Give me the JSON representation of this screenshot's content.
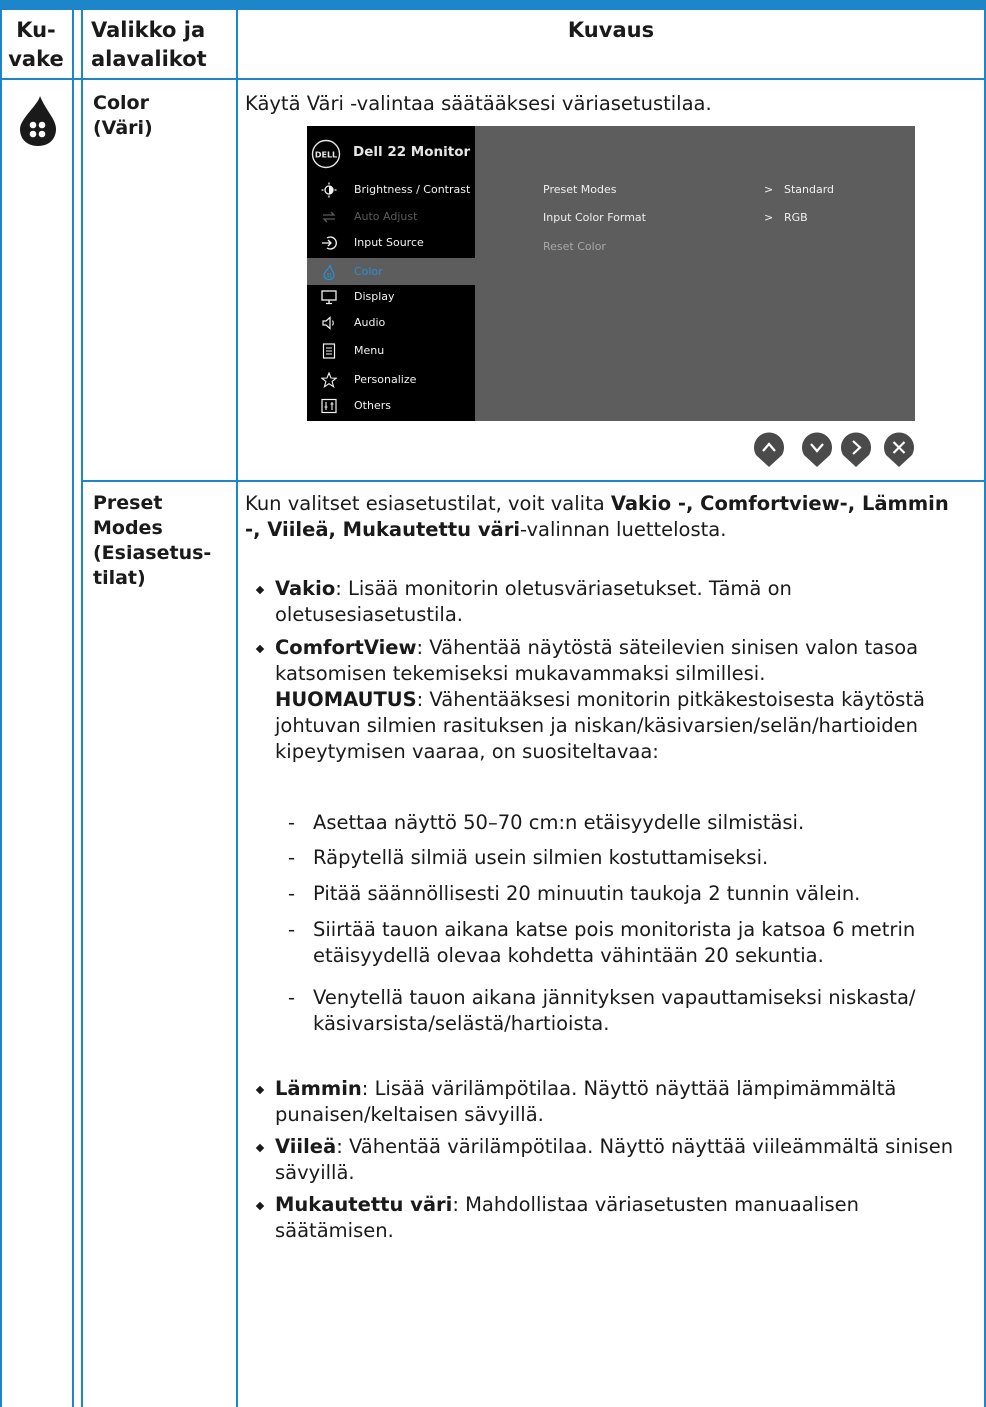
{
  "header": {
    "col_icon": "Ku-\nvake",
    "col_icon_l1": "Ku-",
    "col_icon_l2": "vake",
    "col_menu_l1": "Valikko ja",
    "col_menu_l2": "alavalikot",
    "col_desc": "Kuvaus"
  },
  "row1": {
    "icon": "color-droplet-icon",
    "menu_l1": "Color",
    "menu_l2": "(Väri)",
    "description": "Käytä Väri -valintaa säätääksesi väriasetustilaa."
  },
  "osd": {
    "title": "Dell 22 Monitor",
    "logo_text": "DELL",
    "menu_items": [
      {
        "label": "Brightness / Contrast",
        "icon": "brightness-icon",
        "state": "normal"
      },
      {
        "label": "Auto Adjust",
        "icon": "auto-adjust-icon",
        "state": "disabled"
      },
      {
        "label": "Input Source",
        "icon": "input-source-icon",
        "state": "normal"
      },
      {
        "label": "Color",
        "icon": "color-icon",
        "state": "selected"
      },
      {
        "label": "Display",
        "icon": "display-icon",
        "state": "normal"
      },
      {
        "label": "Audio",
        "icon": "audio-icon",
        "state": "normal"
      },
      {
        "label": "Menu",
        "icon": "menu-icon",
        "state": "normal"
      },
      {
        "label": "Personalize",
        "icon": "star-icon",
        "state": "normal"
      },
      {
        "label": "Others",
        "icon": "others-icon",
        "state": "normal"
      }
    ],
    "submenu": [
      {
        "label": "Preset Modes",
        "arrow": ">",
        "value": "Standard"
      },
      {
        "label": "Input Color Format",
        "arrow": ">",
        "value": "RGB"
      },
      {
        "label": "Reset Color",
        "arrow": "",
        "value": ""
      }
    ],
    "nav_buttons": [
      "up-icon",
      "down-icon",
      "right-icon",
      "close-icon"
    ],
    "colors": {
      "sidebar": "#000000",
      "panel": "#5d5d5d",
      "selected_text": "#2a8fd6",
      "button": "#4a4a4a"
    }
  },
  "row2": {
    "menu_l1": "Preset",
    "menu_l2": "Modes",
    "menu_l3": "(Esiasetus-",
    "menu_l4": "tilat)",
    "intro_a": "Kun valitset esiasetustilat, voit valita ",
    "intro_b1": "Vakio -, Comfortview-, Lämmin",
    "intro_b2": "-, Viileä, Mukautettu väri",
    "intro_c": "-valinnan luettelosta.",
    "vakio_term": "Vakio",
    "vakio_l1": ": Lisää monitorin oletusväriasetukset. Tämä on",
    "vakio_l2": "oletusesiasetustila.",
    "cv_term": "ComfortView",
    "cv_l1": ": Vähentää näytöstä säteilevien sinisen valon tasoa",
    "cv_l2": "katsomisen tekemiseksi mukavammaksi silmillesi.",
    "note_term": "HUOMAUTUS",
    "note_l1": ": Vähentääksesi monitorin pitkäkestoisesta käytöstä",
    "note_l2": "johtuvan silmien rasituksen ja niskan/käsivarsien/selän/hartioiden",
    "note_l3": "kipeytymisen vaaraa, on suositeltavaa:",
    "dash_items": [
      "Asettaa näyttö 50–70 cm:n etäisyydelle silmistäsi.",
      "Räpytellä silmiä usein silmien kostuttamiseksi.",
      "Pitää säännöllisesti 20 minuutin taukoja 2 tunnin välein.",
      "Siirtää tauon aikana katse pois monitorista ja katsoa 6 metrin",
      "etäisyydellä olevaa kohdetta vähintään 20 sekuntia.",
      "Venytellä tauon aikana jännityksen vapauttamiseksi niskasta/",
      "käsivarsista/selästä/hartioista."
    ],
    "warm_term": "Lämmin",
    "warm_l1": ": Lisää värilämpötilaa. Näyttö näyttää lämpimämmältä",
    "warm_l2": "punaisen/keltaisen sävyillä.",
    "cool_term": "Viileä",
    "cool_l1": ": Vähentää värilämpötilaa. Näyttö näyttää viileämmältä sinisen",
    "cool_l2": "sävyillä.",
    "custom_term": "Mukautettu väri",
    "custom_l1": ": Mahdollistaa väriasetusten manuaalisen",
    "custom_l2": "säätämisen."
  },
  "colors": {
    "frame": "#1c86c8",
    "text": "#1a1a1a"
  }
}
